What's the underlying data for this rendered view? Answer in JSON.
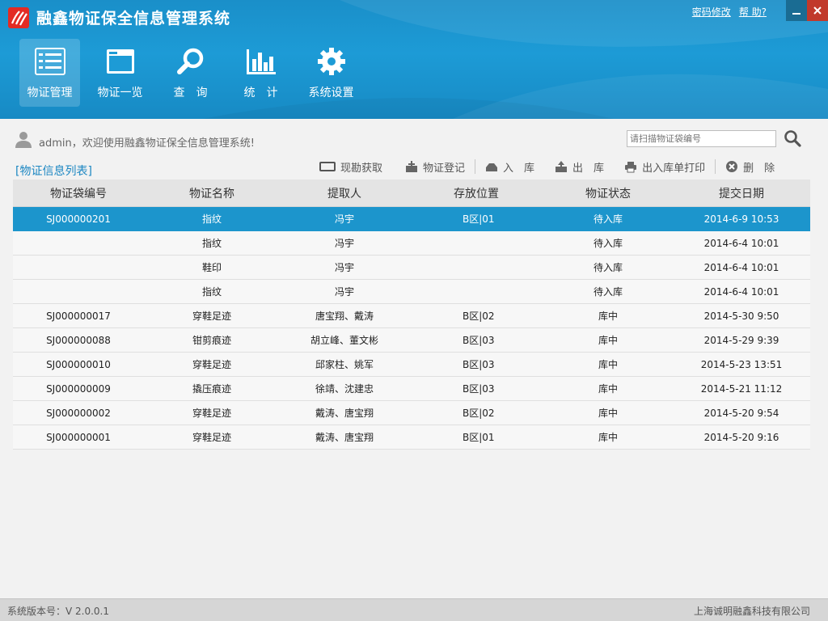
{
  "app": {
    "title": "融鑫物证保全信息管理系统",
    "brand_color": "#1d9bd6"
  },
  "top_links": {
    "password_change": "密码修改",
    "help": "帮 助?"
  },
  "window_controls": {
    "minimize_icon": "minimize-icon",
    "close_icon": "close-icon"
  },
  "nav": [
    {
      "label": "物证管理",
      "icon": "list-icon",
      "active": true
    },
    {
      "label": "物证一览",
      "icon": "window-icon",
      "active": false
    },
    {
      "label": "查　询",
      "icon": "search-icon",
      "active": false
    },
    {
      "label": "统　计",
      "icon": "bar-chart-icon",
      "active": false
    },
    {
      "label": "系统设置",
      "icon": "gear-icon",
      "active": false
    }
  ],
  "user": {
    "welcome": "admin，欢迎使用融鑫物证保全信息管理系统!"
  },
  "search": {
    "placeholder": "请扫描物证袋编号",
    "value": ""
  },
  "list": {
    "title": "[物证信息列表]"
  },
  "toolbar": {
    "scene_fetch": "现勘获取",
    "register": "物证登记",
    "stock_in": "入　库",
    "stock_out": "出　库",
    "print": "出入库单打印",
    "delete": "删　除"
  },
  "table": {
    "columns": [
      "物证袋编号",
      "物证名称",
      "提取人",
      "存放位置",
      "物证状态",
      "提交日期"
    ],
    "rows": [
      {
        "id": "SJ000000201",
        "name": "指纹",
        "extractor": "冯宇",
        "location": "B区|01",
        "status": "待入库",
        "date": "2014-6-9 10:53",
        "selected": true
      },
      {
        "id": "",
        "name": "指纹",
        "extractor": "冯宇",
        "location": "",
        "status": "待入库",
        "date": "2014-6-4 10:01",
        "selected": false
      },
      {
        "id": "",
        "name": "鞋印",
        "extractor": "冯宇",
        "location": "",
        "status": "待入库",
        "date": "2014-6-4 10:01",
        "selected": false
      },
      {
        "id": "",
        "name": "指纹",
        "extractor": "冯宇",
        "location": "",
        "status": "待入库",
        "date": "2014-6-4 10:01",
        "selected": false
      },
      {
        "id": "SJ000000017",
        "name": "穿鞋足迹",
        "extractor": "唐宝翔、戴涛",
        "location": "B区|02",
        "status": "库中",
        "date": "2014-5-30 9:50",
        "selected": false
      },
      {
        "id": "SJ000000088",
        "name": "钳剪痕迹",
        "extractor": "胡立峰、董文彬",
        "location": "B区|03",
        "status": "库中",
        "date": "2014-5-29 9:39",
        "selected": false
      },
      {
        "id": "SJ000000010",
        "name": "穿鞋足迹",
        "extractor": "邱家柱、姚军",
        "location": "B区|03",
        "status": "库中",
        "date": "2014-5-23 13:51",
        "selected": false
      },
      {
        "id": "SJ000000009",
        "name": "撬压痕迹",
        "extractor": "徐靖、沈建忠",
        "location": "B区|03",
        "status": "库中",
        "date": "2014-5-21 11:12",
        "selected": false
      },
      {
        "id": "SJ000000002",
        "name": "穿鞋足迹",
        "extractor": "戴涛、唐宝翔",
        "location": "B区|02",
        "status": "库中",
        "date": "2014-5-20 9:54",
        "selected": false
      },
      {
        "id": "SJ000000001",
        "name": "穿鞋足迹",
        "extractor": "戴涛、唐宝翔",
        "location": "B区|01",
        "status": "库中",
        "date": "2014-5-20 9:16",
        "selected": false
      }
    ]
  },
  "status_bar": {
    "version": "系统版本号：V 2.0.0.1",
    "company": "上海诚明融鑫科技有限公司"
  }
}
